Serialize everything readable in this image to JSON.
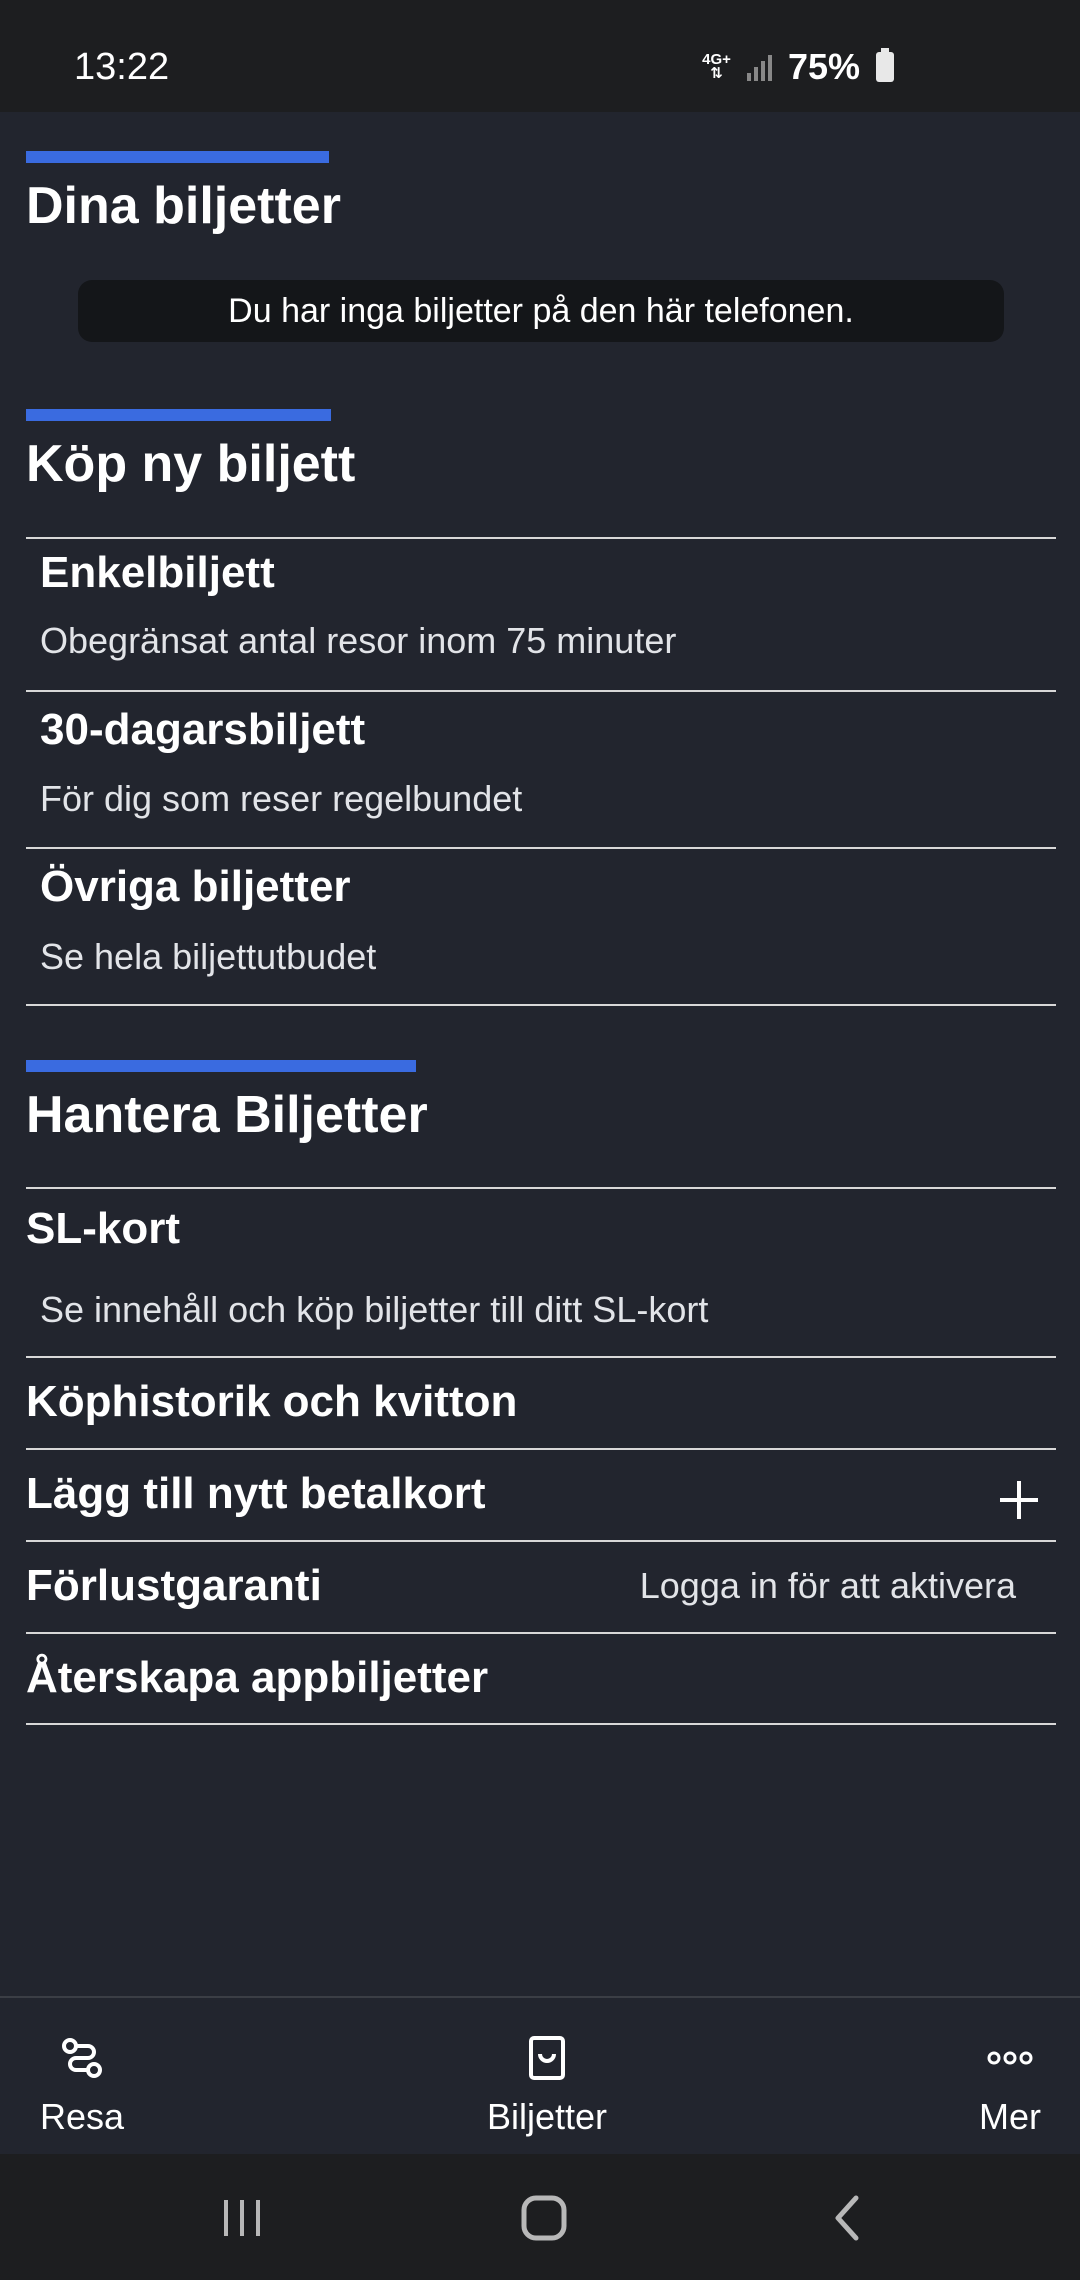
{
  "status": {
    "time": "13:22",
    "network": "4G+",
    "battery": "75%"
  },
  "sections": {
    "my_tickets": {
      "title": "Dina biljetter",
      "empty_message": "Du har inga biljetter på den här telefonen."
    },
    "buy": {
      "title": "Köp ny biljett",
      "items": [
        {
          "title": "Enkelbiljett",
          "subtitle": "Obegränsat antal resor inom 75 minuter"
        },
        {
          "title": "30-dagarsbiljett",
          "subtitle": "För dig som reser regelbundet"
        },
        {
          "title": "Övriga biljetter",
          "subtitle": "Se hela biljettutbudet"
        }
      ]
    },
    "manage": {
      "title": "Hantera Biljetter",
      "sl_card": {
        "title": "SL-kort",
        "subtitle": "Se innehåll och köp biljetter till ditt SL-kort"
      },
      "rows": [
        {
          "title": "Köphistorik och kvitton"
        },
        {
          "title": "Lägg till nytt betalkort",
          "icon": "plus-icon"
        },
        {
          "title": "Förlustgaranti",
          "right": "Logga in för att aktivera"
        },
        {
          "title": "Återskapa appbiljetter"
        }
      ]
    }
  },
  "bottom_nav": [
    {
      "label": "Resa",
      "icon": "route-icon"
    },
    {
      "label": "Biljetter",
      "icon": "ticket-icon"
    },
    {
      "label": "Mer",
      "icon": "more-dots-icon"
    }
  ],
  "system_nav": [
    "recent-apps-icon",
    "home-icon",
    "back-icon"
  ],
  "colors": {
    "background": "#22252e",
    "accent": "#3a6be0",
    "status_bar": "#1d1e20"
  }
}
